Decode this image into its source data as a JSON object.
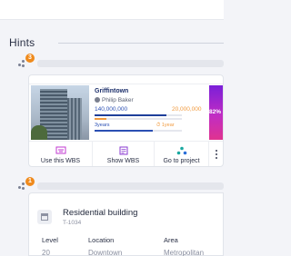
{
  "hints": {
    "title": "Hints",
    "hint1_badge": "3",
    "hint2_badge": "1"
  },
  "project_card": {
    "name": "Griffintown",
    "owner": "Philip Baker",
    "budget": "140,000,000",
    "spent": "20,000,000",
    "duration": "3years",
    "remaining": "1year",
    "progress_percent": "82%",
    "budget_progress": 0.82,
    "spent_progress": 0.14,
    "time_progress": 0.67,
    "actions": [
      {
        "label": "Use this WBS",
        "icon": "wbs-template-icon"
      },
      {
        "label": "Show WBS",
        "icon": "wbs-view-icon"
      },
      {
        "label": "Go to project",
        "icon": "project-nodes-icon"
      }
    ],
    "accent_color": "#1e3f9a",
    "warning_color": "#f19a3e"
  },
  "wbs_card": {
    "name": "Residential building",
    "code": "T-1034",
    "columns": [
      {
        "header": "Level",
        "value": "20"
      },
      {
        "header": "Location",
        "value": "Downtown"
      },
      {
        "header": "Area",
        "value": "Metropolitan"
      }
    ]
  },
  "colors": {
    "badge": "#ef8a1c",
    "gradient_start": "#7a1fd8",
    "gradient_end": "#e0338f"
  }
}
